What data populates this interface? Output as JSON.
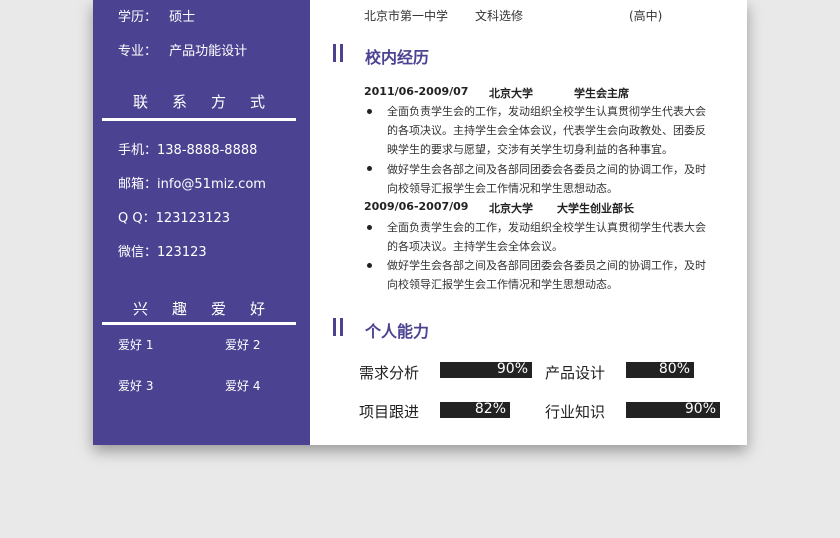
{
  "colors": {
    "accent": "#4b4392",
    "bar": "#222222"
  },
  "sidebar": {
    "degree": {
      "label": "学历：",
      "value": "硕士"
    },
    "major": {
      "label": "专业：",
      "value": "产品功能设计"
    },
    "contact_title": "联系方式",
    "phone": {
      "label": "手机：",
      "value": "138-8888-8888"
    },
    "email": {
      "label": "邮箱：",
      "value": "info@51miz.com"
    },
    "qq": {
      "label": "Q Q：",
      "value": "123123123"
    },
    "wechat": {
      "label": "微信：",
      "value": "123123"
    },
    "hobbies_title": "兴趣爱好",
    "hobbies": [
      "爱好 1",
      "爱好 2",
      "爱好 3",
      "爱好 4"
    ]
  },
  "education": {
    "school": "北京市第一中学",
    "subject": "文科选修",
    "level": "(高中)"
  },
  "campus": {
    "title": "校内经历",
    "entries": [
      {
        "period": "2011/06-2009/07",
        "org": "北京大学",
        "role": "学生会主席",
        "bullets": [
          "全面负责学生会的工作，发动组织全校学生认真贯彻学生代表大会的各项决议。主持学生会全体会议，代表学生会向政教处、团委反映学生的要求与愿望，交涉有关学生切身利益的各种事宜。",
          "做好学生会各部之间及各部同团委会各委员之间的协调工作，及时向校领导汇报学生会工作情况和学生思想动态。"
        ]
      },
      {
        "period": "2009/06-2007/09",
        "org": "北京大学",
        "role": "大学生创业部长",
        "bullets": [
          "全面负责学生会的工作，发动组织全校学生认真贯彻学生代表大会的各项决议。主持学生会全体会议。",
          "做好学生会各部之间及各部同团委会各委员之间的协调工作，及时向校领导汇报学生会工作情况和学生思想动态。"
        ]
      }
    ]
  },
  "skills": {
    "title": "个人能力",
    "items": [
      {
        "name": "需求分析",
        "value": "90%",
        "level": 0.9
      },
      {
        "name": "产品设计",
        "value": "80%",
        "level": 0.8
      },
      {
        "name": "项目跟进",
        "value": "82%",
        "level": 0.82
      },
      {
        "name": "行业知识",
        "value": "90%",
        "level": 0.9
      }
    ]
  }
}
